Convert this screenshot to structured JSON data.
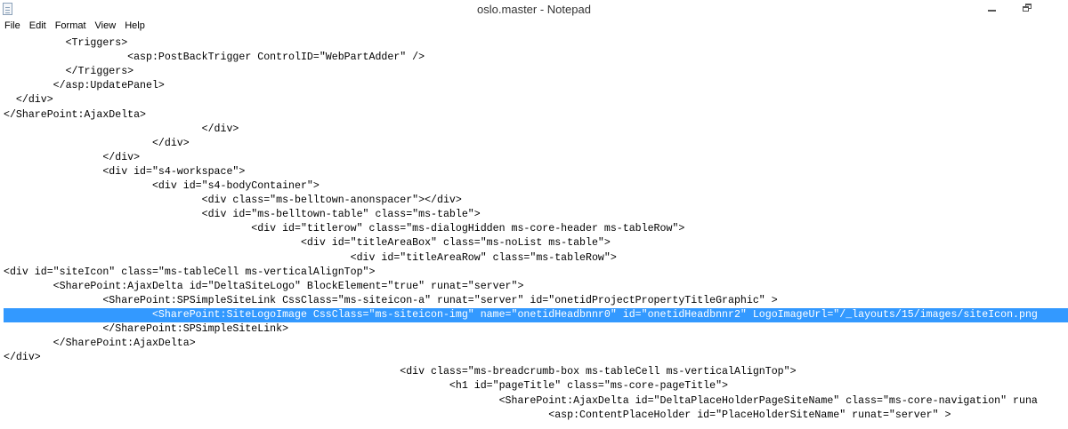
{
  "window": {
    "title": "oslo.master - Notepad",
    "icon": "notepad-icon",
    "controls": [
      "minimize-icon",
      "restore-icon"
    ]
  },
  "menu": {
    "items": [
      "File",
      "Edit",
      "Format",
      "View",
      "Help"
    ]
  },
  "editor": {
    "selected_line_index": 20,
    "lines": [
      "          <Triggers>",
      "                    <asp:PostBackTrigger ControlID=\"WebPartAdder\" />",
      "          </Triggers>",
      "        </asp:UpdatePanel>",
      "  </div>",
      "</SharePoint:AjaxDelta>",
      "                                </div>",
      "                        </div>",
      "                </div>",
      "                <div id=\"s4-workspace\">",
      "                        <div id=\"s4-bodyContainer\">",
      "                                <div class=\"ms-belltown-anonspacer\"></div>",
      "                                <div id=\"ms-belltown-table\" class=\"ms-table\">",
      "                                        <div id=\"titlerow\" class=\"ms-dialogHidden ms-core-header ms-tableRow\">",
      "                                                <div id=\"titleAreaBox\" class=\"ms-noList ms-table\">",
      "                                                        <div id=\"titleAreaRow\" class=\"ms-tableRow\">",
      "<div id=\"siteIcon\" class=\"ms-tableCell ms-verticalAlignTop\">",
      "        <SharePoint:AjaxDelta id=\"DeltaSiteLogo\" BlockElement=\"true\" runat=\"server\">",
      "                <SharePoint:SPSimpleSiteLink CssClass=\"ms-siteicon-a\" runat=\"server\" id=\"onetidProjectPropertyTitleGraphic\" >",
      "",
      "                        <SharePoint:SiteLogoImage CssClass=\"ms-siteicon-img\" name=\"onetidHeadbnnr0\" id=\"onetidHeadbnnr2\" LogoImageUrl=\"/_layouts/15/images/siteIcon.png",
      "                </SharePoint:SPSimpleSiteLink>",
      "        </SharePoint:AjaxDelta>",
      "</div>",
      "                                                                <div class=\"ms-breadcrumb-box ms-tableCell ms-verticalAlignTop\">",
      "                                                                        <h1 id=\"pageTitle\" class=\"ms-core-pageTitle\">",
      "                                                                                <SharePoint:AjaxDelta id=\"DeltaPlaceHolderPageSiteName\" class=\"ms-core-navigation\" runa",
      "                                                                                        <asp:ContentPlaceHolder id=\"PlaceHolderSiteName\" runat=\"server\" >"
    ]
  }
}
